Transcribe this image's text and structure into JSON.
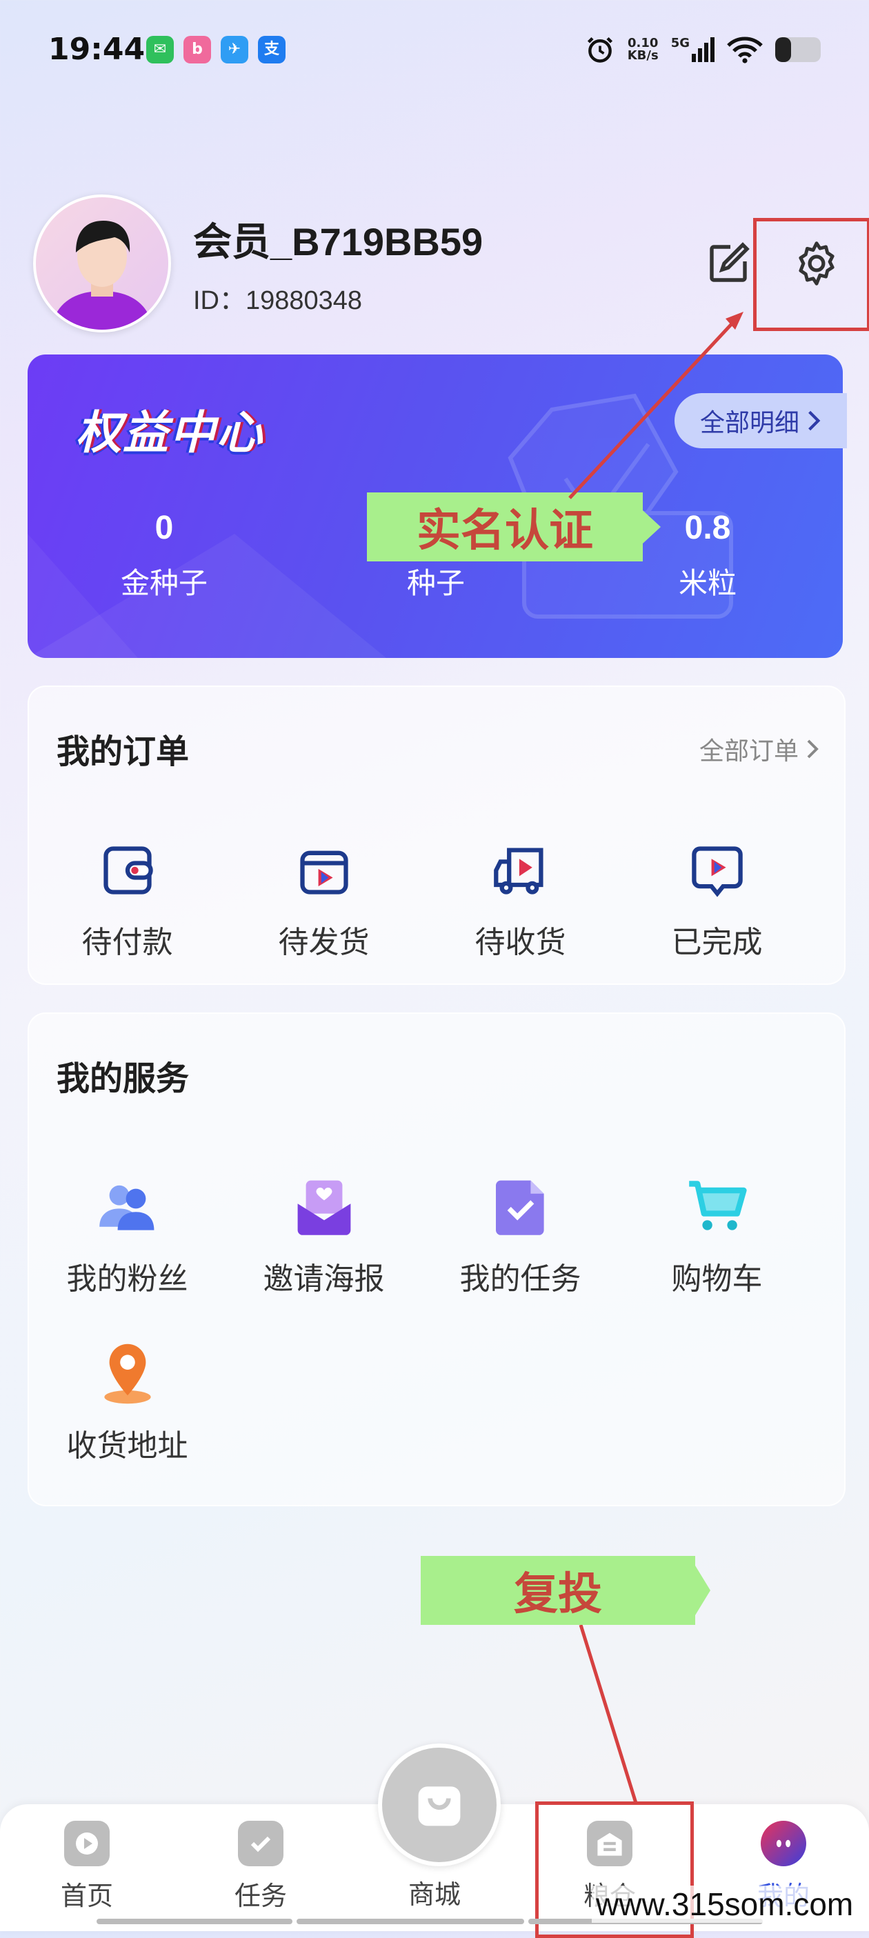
{
  "status_bar": {
    "time": "19:44",
    "apps": [
      {
        "icon": "wechat-icon",
        "glyph": "✉",
        "color": "#2fc05c"
      },
      {
        "icon": "bilibili-icon",
        "glyph": "b",
        "color": "#f06a9c"
      },
      {
        "icon": "browser-icon",
        "glyph": "✈",
        "color": "#2f9df4"
      },
      {
        "icon": "alipay-icon",
        "glyph": "支",
        "color": "#1f7cf0"
      }
    ],
    "net_speed_value": "0.10",
    "net_speed_unit": "KB/s",
    "network": "5G",
    "battery_level": 0.35
  },
  "profile": {
    "username": "会员_B719BB59",
    "id_text": "ID：19880348"
  },
  "rights_center": {
    "title": "权益中心",
    "detail_link": "全部明细",
    "stats": [
      {
        "value": "0",
        "label": "金种子"
      },
      {
        "value": "",
        "label": "种子"
      },
      {
        "value": "0.8",
        "label": "米粒"
      }
    ]
  },
  "annotations": {
    "realname": "实名认证",
    "reinvest": "复投"
  },
  "orders": {
    "title": "我的订单",
    "all_link": "全部订单",
    "items": [
      {
        "label": "待付款",
        "icon": "wallet-icon"
      },
      {
        "label": "待发货",
        "icon": "package-icon"
      },
      {
        "label": "待收货",
        "icon": "truck-icon"
      },
      {
        "label": "已完成",
        "icon": "completed-icon"
      }
    ]
  },
  "services": {
    "title": "我的服务",
    "items": [
      {
        "label": "我的粉丝",
        "icon": "fans-icon"
      },
      {
        "label": "邀请海报",
        "icon": "invite-poster-icon"
      },
      {
        "label": "我的任务",
        "icon": "task-icon"
      },
      {
        "label": "购物车",
        "icon": "cart-icon"
      },
      {
        "label": "收货地址",
        "icon": "location-icon"
      }
    ]
  },
  "bottom_nav": {
    "items": [
      {
        "label": "首页",
        "icon": "home-play-icon"
      },
      {
        "label": "任务",
        "icon": "task-check-icon"
      },
      {
        "label": "商城",
        "icon": "mall-bag-icon"
      },
      {
        "label": "粮仓",
        "icon": "granary-icon"
      },
      {
        "label": "我的",
        "icon": "profile-icon"
      }
    ],
    "active": "我的"
  },
  "watermark": "www.315som.com",
  "colors": {
    "accent": "#3b57e0",
    "callout_bg": "#a8ef8c",
    "callout_text": "#c6473b",
    "highlight_box": "#d64141"
  }
}
